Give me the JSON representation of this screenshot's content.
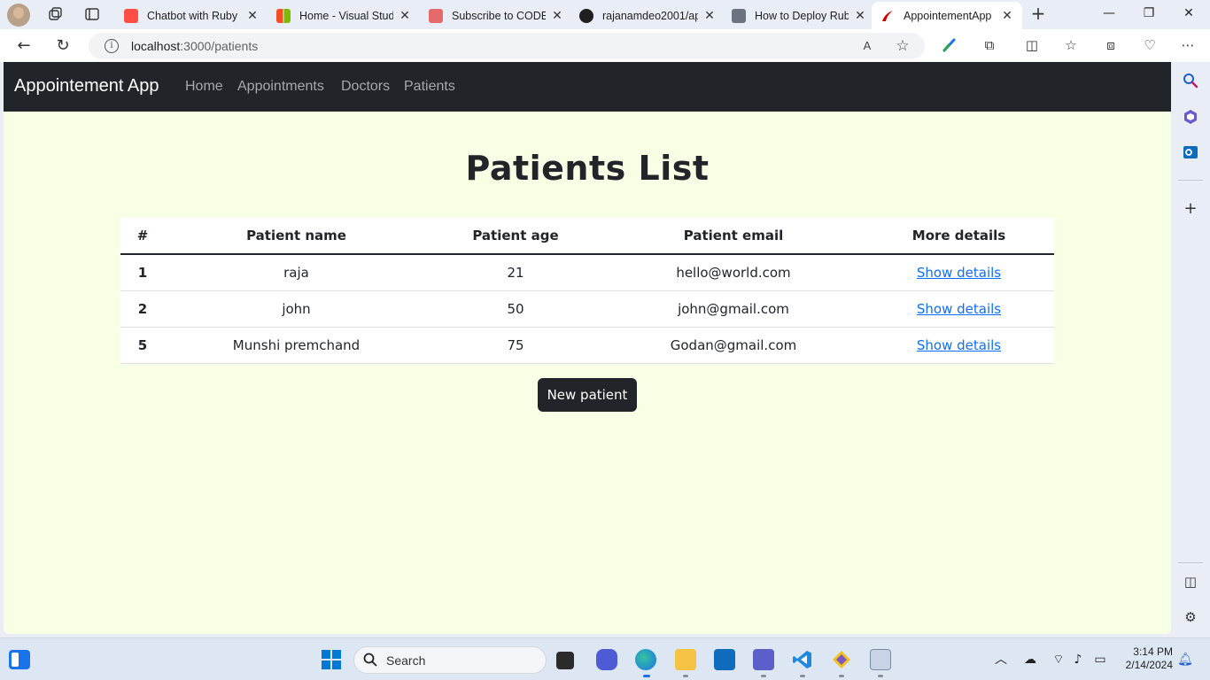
{
  "browser": {
    "tabs": [
      {
        "title": "Chatbot with Ruby c",
        "favicon": "youtube-icon",
        "color": "#ff0000"
      },
      {
        "title": "Home - Visual Studi",
        "favicon": "microsoft-icon",
        "color": "#7fba00"
      },
      {
        "title": "Subscribe to CODE F",
        "favicon": "code-c-icon",
        "color": "#e03a3a"
      },
      {
        "title": "rajanamdeo2001/ap",
        "favicon": "github-icon",
        "color": "#1f1f1f"
      },
      {
        "title": "How to Deploy Rub",
        "favicon": "b4a-icon",
        "color": "#5a6270"
      },
      {
        "title": "AppointementApp",
        "favicon": "rails-icon",
        "color": "#d30001"
      }
    ],
    "address": {
      "host": "localhost",
      "path": ":3000/patients"
    }
  },
  "app": {
    "brand": "Appointement App",
    "nav": [
      "Home",
      "Appointments",
      "Doctors",
      "Patients"
    ]
  },
  "page": {
    "title": "Patients List",
    "columns": [
      "#",
      "Patient name",
      "Patient age",
      "Patient email",
      "More details"
    ],
    "rows": [
      {
        "id": "1",
        "name": "raja",
        "age": "21",
        "email": "hello@world.com",
        "link": "Show details"
      },
      {
        "id": "2",
        "name": "john",
        "age": "50",
        "email": "john@gmail.com",
        "link": "Show details"
      },
      {
        "id": "5",
        "name": "Munshi premchand",
        "age": "75",
        "email": "Godan@gmail.com",
        "link": "Show details"
      }
    ],
    "new_button": "New patient"
  },
  "taskbar": {
    "search": "Search",
    "time": "3:14 PM",
    "date": "2/14/2024"
  }
}
